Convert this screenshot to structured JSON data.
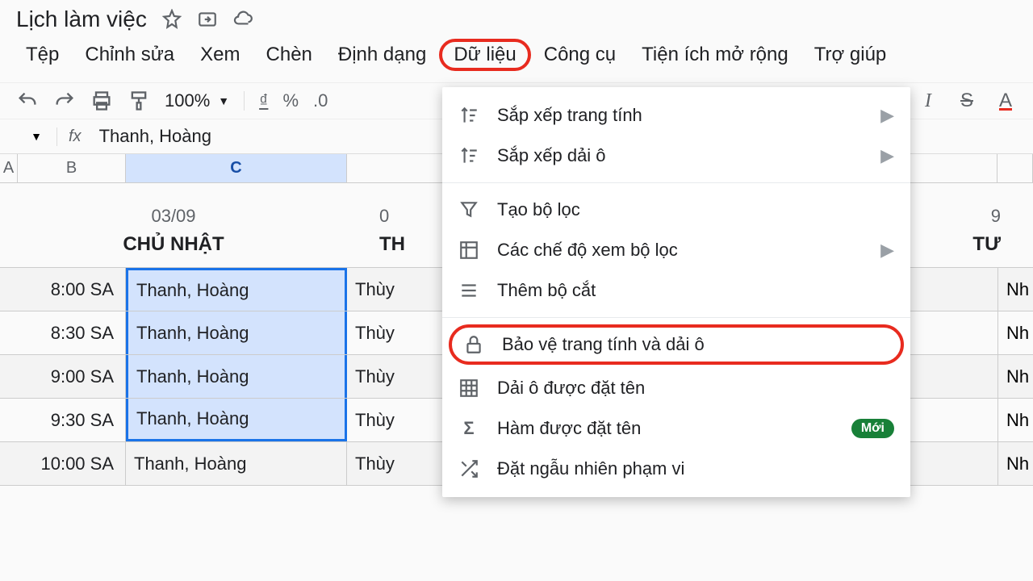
{
  "title": "Lịch làm việc",
  "menu": [
    "Tệp",
    "Chỉnh sửa",
    "Xem",
    "Chèn",
    "Định dạng",
    "Dữ liệu",
    "Công cụ",
    "Tiện ích mở rộng",
    "Trợ giúp"
  ],
  "active_menu_index": 5,
  "toolbar": {
    "zoom": "100%",
    "currency": "₫",
    "percent": "%",
    "decimal": ".0"
  },
  "formula_bar": {
    "fx": "fx",
    "value": "Thanh, Hoàng"
  },
  "columns": [
    "A",
    "B",
    "C"
  ],
  "selected_column": "C",
  "days": [
    {
      "date": "03/09",
      "name": "CHỦ NHẬT"
    },
    {
      "date_partial": "0",
      "name_partial": "TH"
    },
    {
      "date_partial": "9",
      "name_partial": "TƯ"
    }
  ],
  "rows": [
    {
      "time": "8:00 SA",
      "c": "Thanh, Hoàng",
      "d": "Thùy",
      "r": "Nh"
    },
    {
      "time": "8:30 SA",
      "c": "Thanh, Hoàng",
      "d": "Thùy",
      "r": "Nh"
    },
    {
      "time": "9:00 SA",
      "c": "Thanh, Hoàng",
      "d": "Thùy",
      "r": "Nh"
    },
    {
      "time": "9:30 SA",
      "c": "Thanh, Hoàng",
      "d": "Thùy",
      "r": "Nh"
    },
    {
      "time": "10:00 SA",
      "c": "Thanh, Hoàng",
      "d": "Thùy",
      "r": "Nh"
    }
  ],
  "dropdown": {
    "items": [
      {
        "icon": "sort-sheet",
        "label": "Sắp xếp trang tính",
        "submenu": true
      },
      {
        "icon": "sort-range",
        "label": "Sắp xếp dải ô",
        "submenu": true
      },
      {
        "sep": true
      },
      {
        "icon": "filter",
        "label": "Tạo bộ lọc"
      },
      {
        "icon": "filter-views",
        "label": "Các chế độ xem bộ lọc",
        "submenu": true
      },
      {
        "icon": "slicer",
        "label": "Thêm bộ cắt"
      },
      {
        "sep": true
      },
      {
        "icon": "lock",
        "label": "Bảo vệ trang tính và dải ô",
        "highlighted": true
      },
      {
        "icon": "named-ranges",
        "label": "Dải ô được đặt tên"
      },
      {
        "icon": "sigma",
        "label": "Hàm được đặt tên",
        "badge": "Mới"
      },
      {
        "icon": "shuffle",
        "label": "Đặt ngẫu nhiên phạm vi"
      }
    ]
  }
}
